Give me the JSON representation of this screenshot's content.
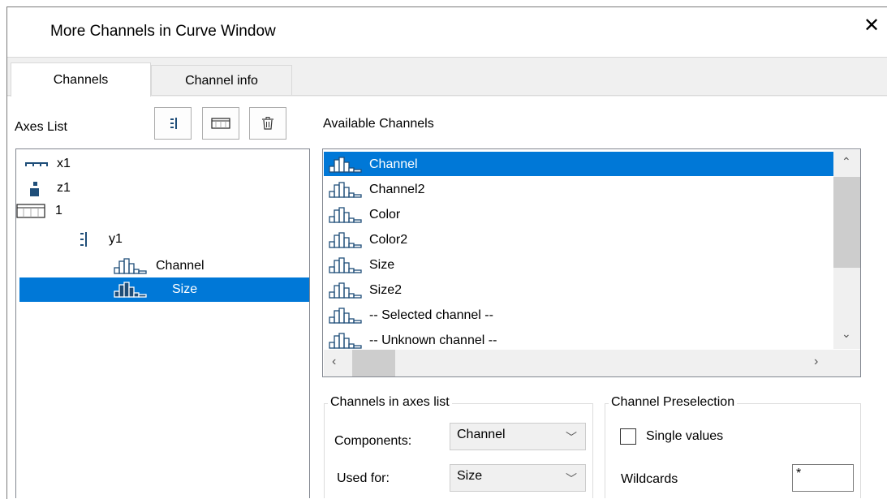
{
  "window": {
    "title": "More Channels in Curve Window",
    "close_glyph": "✕"
  },
  "tabs": [
    {
      "label": "Channels",
      "active": true
    },
    {
      "label": "Channel info",
      "active": false
    }
  ],
  "axes_list": {
    "label": "Axes List",
    "toolbar": [
      "add-y-axis-icon",
      "add-table-icon",
      "trash-icon"
    ],
    "items": [
      {
        "label": "x1",
        "icon": "x-axis-icon"
      },
      {
        "label": "z1",
        "icon": "z-axis-icon"
      },
      {
        "label": "1",
        "icon": "table-icon"
      },
      {
        "label": "y1",
        "icon": "y-axis-icon"
      },
      {
        "label": "Channel",
        "icon": "channel-icon"
      },
      {
        "label": "Size",
        "icon": "channel-icon",
        "selected": true
      }
    ]
  },
  "available_channels": {
    "label": "Available Channels",
    "items": [
      {
        "label": "Channel",
        "selected": true
      },
      {
        "label": "Channel2"
      },
      {
        "label": "Color"
      },
      {
        "label": "Color2"
      },
      {
        "label": "Size"
      },
      {
        "label": "Size2"
      },
      {
        "label": "-- Selected channel --"
      },
      {
        "label": "-- Unknown channel --"
      }
    ]
  },
  "channels_in_axes": {
    "caption": "Channels in axes list",
    "components_label": "Components:",
    "components_value": "Channel",
    "used_for_label": "Used for:",
    "used_for_value": "Size"
  },
  "preselection": {
    "caption": "Channel Preselection",
    "single_values_label": "Single values",
    "single_values_checked": false,
    "wildcards_label": "Wildcards",
    "wildcards_value": "*"
  },
  "colors": {
    "selection": "#0078d7",
    "icon": "#1f4e79",
    "tab_bg": "#f0f0f0"
  }
}
